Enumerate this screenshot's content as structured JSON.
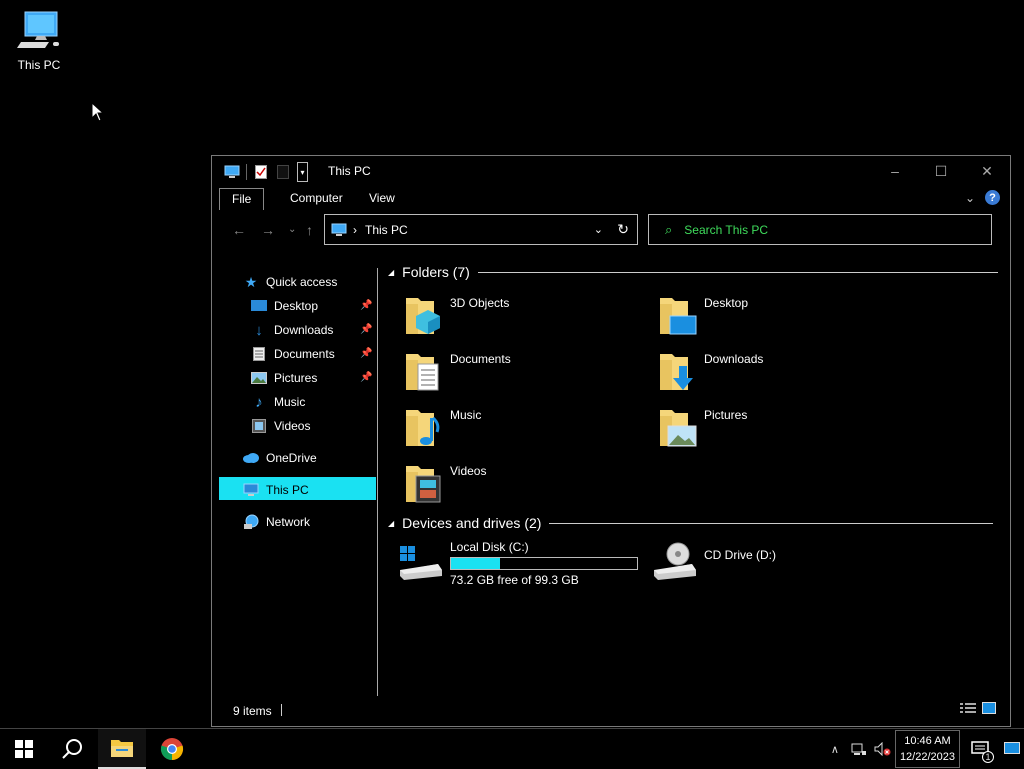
{
  "desktop": {
    "this_pc_label": "This PC"
  },
  "window": {
    "title": "This PC",
    "tabs": {
      "file": "File",
      "computer": "Computer",
      "view": "View"
    },
    "address": {
      "location": "This PC"
    },
    "search": {
      "placeholder": "Search This PC"
    },
    "nav": {
      "quick_access": "Quick access",
      "desktop": "Desktop",
      "downloads": "Downloads",
      "documents": "Documents",
      "pictures": "Pictures",
      "music": "Music",
      "videos": "Videos",
      "onedrive": "OneDrive",
      "this_pc": "This PC",
      "network": "Network"
    },
    "folders_header": "Folders (7)",
    "folders": {
      "objects3d": "3D Objects",
      "desktop": "Desktop",
      "documents": "Documents",
      "downloads": "Downloads",
      "music": "Music",
      "pictures": "Pictures",
      "videos": "Videos"
    },
    "devices_header": "Devices and drives (2)",
    "drives": {
      "c_name": "Local Disk (C:)",
      "c_free": "73.2 GB free of 99.3 GB",
      "c_used_fraction": 0.263,
      "d_name": "CD Drive (D:)"
    },
    "status": {
      "items": "9 items"
    }
  },
  "taskbar": {
    "time": "10:46 AM",
    "date": "12/22/2023",
    "notification_count": "1"
  },
  "colors": {
    "accent_cyan": "#1ae1f2",
    "search_green": "#3fdc5c",
    "folder_yellow": "#f5d67a"
  }
}
